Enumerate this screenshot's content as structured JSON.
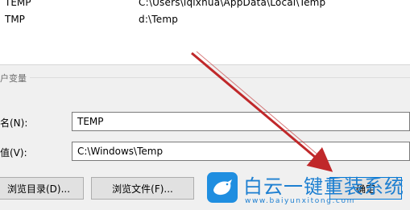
{
  "list": {
    "rows": [
      {
        "name": "TEMP",
        "value": "C:\\Users\\lqlxhua\\AppData\\Local\\Temp"
      },
      {
        "name": "TMP",
        "value": "d:\\Temp"
      }
    ]
  },
  "group": {
    "label": "户变量"
  },
  "form": {
    "name_label": "名(N):",
    "name_value": "TEMP",
    "value_label": "值(V):",
    "value_value": "C:\\Windows\\Temp"
  },
  "buttons": {
    "browse_dir": "浏览目录(D)...",
    "browse_file": "浏览文件(F)...",
    "ok": "确定"
  },
  "watermark": {
    "title": "白云一键重装系统",
    "url": "www.baiyunxitong.com"
  },
  "colors": {
    "arrow": "#c0282a",
    "brand": "#1d7fd1"
  }
}
